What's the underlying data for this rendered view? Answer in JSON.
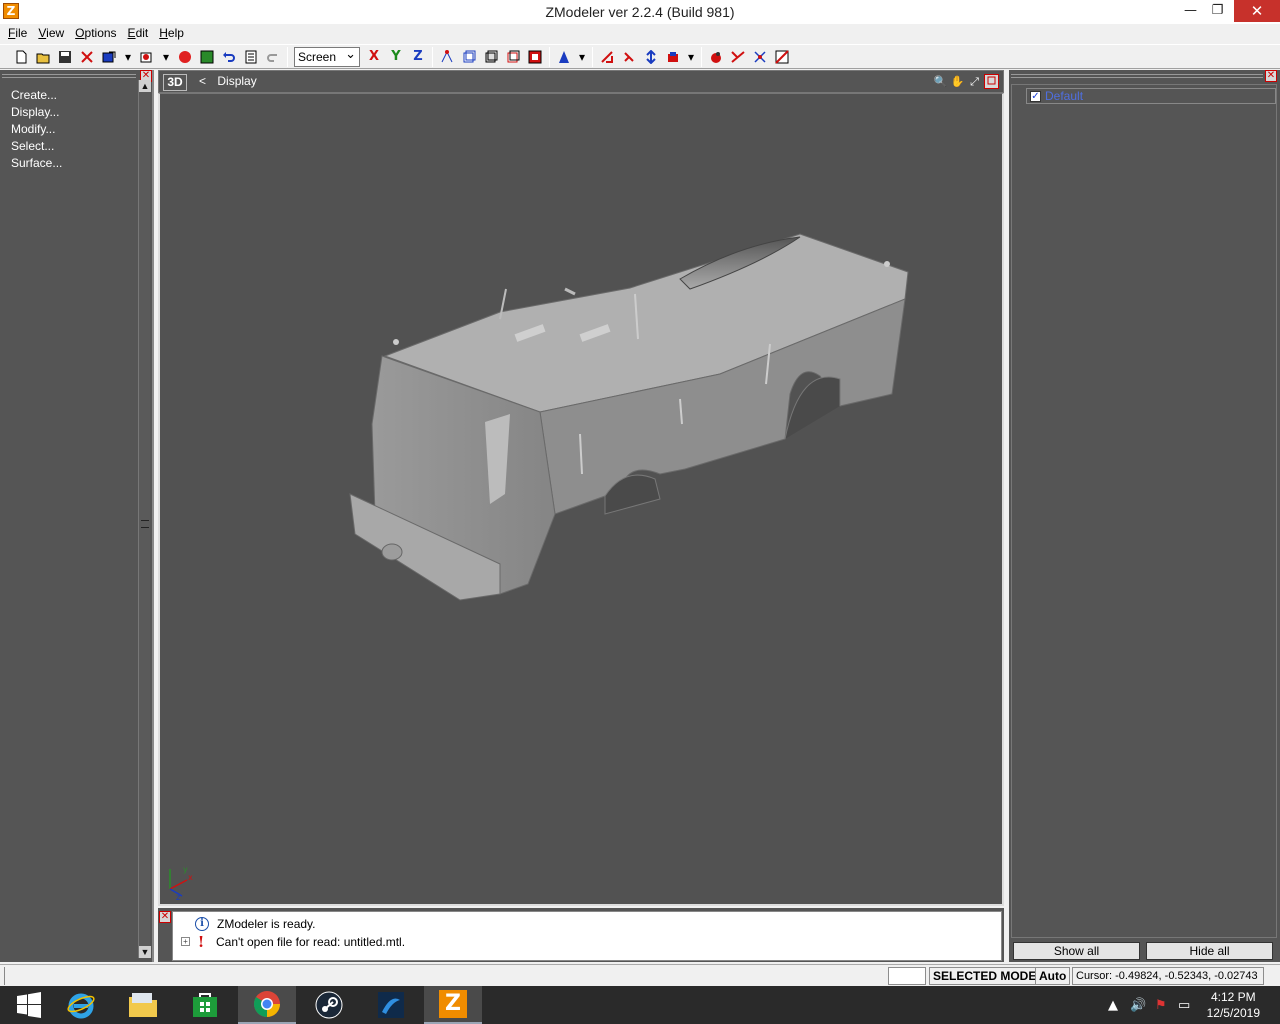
{
  "window": {
    "title": "ZModeler ver 2.2.4 (Build 981)",
    "app_icon_letter": "Z",
    "minimize_glyph": "—",
    "restore_glyph": "❐",
    "close_glyph": "✕"
  },
  "menu": [
    "File",
    "View",
    "Options",
    "Edit",
    "Help"
  ],
  "toolbar": {
    "view_select": "Screen",
    "axes": [
      "X",
      "Y",
      "Z"
    ]
  },
  "left_panel": {
    "close_glyph": "✕",
    "items": [
      "Create...",
      "Display...",
      "Modify...",
      "Select...",
      "Surface..."
    ],
    "scroll_up": "▲",
    "scroll_down": "▼"
  },
  "viewport": {
    "view_label": "3D",
    "breadcrumb_arrow": "<",
    "mode_label": "Display",
    "axis_labels": [
      "y",
      "x",
      "z"
    ]
  },
  "right_panel": {
    "close_glyph": "✕",
    "object_checked_glyph": "✓",
    "object_label": "Default",
    "show_all": "Show all",
    "hide_all": "Hide all"
  },
  "log": {
    "close_glyph": "✕",
    "entries": [
      {
        "icon": "info-icon",
        "glyph": "i",
        "text": "ZModeler is ready."
      },
      {
        "icon": "warning-icon",
        "glyph": "!",
        "text": "Can't open file for read: untitled.mtl."
      }
    ],
    "expand_glyph": "+"
  },
  "statusbar": {
    "mode": "SELECTED MODE",
    "auto": "Auto",
    "cursor": "Cursor: -0.49824, -0.52343, -0.02743"
  },
  "taskbar": {
    "apps": [
      "windows-start",
      "internet-explorer",
      "file-explorer",
      "store",
      "chrome",
      "steam",
      "app-blue",
      "zmodeler"
    ],
    "zmodeler_letter": "Z",
    "tray_up_glyph": "▲",
    "volume_glyph": "🔊",
    "flag_glyph": "⚑",
    "network_glyph": "▭",
    "time": "4:12 PM",
    "date": "12/5/2019"
  },
  "colors": {
    "panel_bg": "#555555",
    "viewport_bg": "#525252",
    "accent_red": "#c7312b",
    "zmodeler_orange": "#f08c00"
  }
}
